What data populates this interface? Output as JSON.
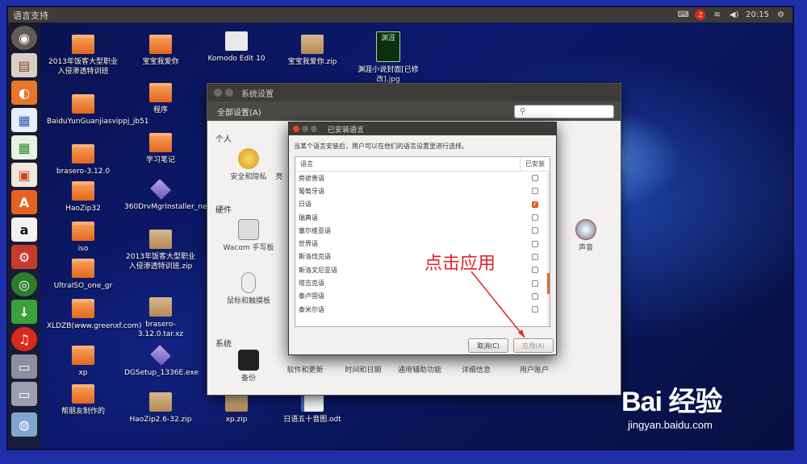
{
  "topbar": {
    "title": "语言支持",
    "clock": "20:15"
  },
  "desktop_icons": [
    {
      "label": "2013年饭客大型职业入侵渗透特训班",
      "kind": "folder"
    },
    {
      "label": "BaiduYunGuanjiasvippj_jb51",
      "kind": "folder"
    },
    {
      "label": "brasero-3.12.0",
      "kind": "folder"
    },
    {
      "label": "HaoZip32",
      "kind": "folder"
    },
    {
      "label": "iso",
      "kind": "folder"
    },
    {
      "label": "UltraISO_one_gr",
      "kind": "folder"
    },
    {
      "label": "XLDZB(www.greenxf.com)",
      "kind": "folder"
    },
    {
      "label": "xp",
      "kind": "folder"
    },
    {
      "label": "帮朋友制作的",
      "kind": "folder"
    },
    {
      "label": "宝宝我爱你",
      "kind": "folder"
    },
    {
      "label": "程序",
      "kind": "folder"
    },
    {
      "label": "学习笔记",
      "kind": "folder"
    },
    {
      "label": "360DrvMgrInstaller_net.exe",
      "kind": "gem"
    },
    {
      "label": "2013年饭客大型职业入侵渗透特训班.zip",
      "kind": "zip"
    },
    {
      "label": "brasero-3.12.0.tar.xz",
      "kind": "zip"
    },
    {
      "label": "DGSetup_1336E.exe",
      "kind": "gem"
    },
    {
      "label": "HaoZip2.6-32.zip",
      "kind": "zip"
    },
    {
      "label": "Komodo Edit 10",
      "kind": "ko"
    },
    {
      "label": "宝宝我爱你.zip",
      "kind": "zip"
    },
    {
      "label": "渊涯小说封面[已修改].jpg",
      "kind": "book"
    },
    {
      "label": "xp.zip",
      "kind": "zip"
    },
    {
      "label": "日语五十音图.odt",
      "kind": "doc"
    }
  ],
  "book_cover_text": "渊涯",
  "settings": {
    "window_title": "系统设置",
    "all_settings": "全部设置(A)",
    "sections": {
      "personal": "个人",
      "hardware": "硬件",
      "system": "系统"
    },
    "items": {
      "security": "安全和隐私",
      "partial": "亮",
      "wacom": "Wacom 手写板",
      "mouse": "鼠标和触摸板",
      "sound": "声音",
      "backup": "备份",
      "software": "软件和更新",
      "datetime": "时间和日期",
      "access": "通用辅助功能",
      "details": "详细信息",
      "users": "用户账户"
    }
  },
  "dialog": {
    "title": "已安装语言",
    "description": "当某个语言安装后，用户可以在他们的语言设置里进行选择。",
    "col_language": "语言",
    "col_installed": "已安装",
    "languages": [
      {
        "name": "旁遮普语",
        "installed": false
      },
      {
        "name": "葡萄牙语",
        "installed": false
      },
      {
        "name": "日语",
        "installed": true
      },
      {
        "name": "瑞典语",
        "installed": false
      },
      {
        "name": "塞尔维亚语",
        "installed": false
      },
      {
        "name": "世界语",
        "installed": false
      },
      {
        "name": "斯洛伐克语",
        "installed": false
      },
      {
        "name": "斯洛文尼亚语",
        "installed": false
      },
      {
        "name": "塔吉克语",
        "installed": false
      },
      {
        "name": "泰卢固语",
        "installed": false
      },
      {
        "name": "泰米尔语",
        "installed": false
      }
    ],
    "cancel_label": "取消(C)",
    "apply_label": "应用(A)"
  },
  "annotation": "点击应用",
  "watermark": {
    "brand": "Bai 经验",
    "site": "jingyan.baidu.com"
  },
  "colors": {
    "accent": "#e2692a",
    "annotation": "#e0242a"
  }
}
